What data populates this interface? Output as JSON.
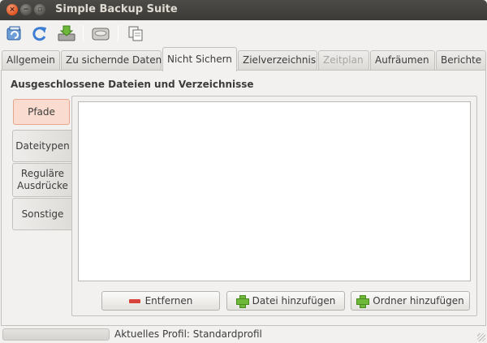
{
  "window": {
    "title": "Simple Backup Suite",
    "close_glyph": "×",
    "min_glyph": "−",
    "max_glyph": "▫"
  },
  "toolbar": {
    "icons": [
      "reload-profile-icon",
      "refresh-icon",
      "save-download-icon",
      "drive-backup-icon",
      "copy-icon"
    ]
  },
  "tabs": [
    {
      "label": "Allgemein",
      "state": "normal"
    },
    {
      "label": "Zu sichernde Daten",
      "state": "normal"
    },
    {
      "label": "Nicht Sichern",
      "state": "active"
    },
    {
      "label": "Zielverzeichnis",
      "state": "normal"
    },
    {
      "label": "Zeitplan",
      "state": "disabled"
    },
    {
      "label": "Aufräumen",
      "state": "normal"
    },
    {
      "label": "Berichte",
      "state": "normal"
    }
  ],
  "section": {
    "title": "Ausgeschlossene Dateien und Verzeichnisse"
  },
  "side_tabs": [
    {
      "label": "Pfade",
      "active": true
    },
    {
      "label": "Dateitypen",
      "active": false
    },
    {
      "label": "Reguläre Ausdrücke",
      "active": false
    },
    {
      "label": "Sonstige",
      "active": false
    }
  ],
  "buttons": {
    "remove": "Entfernen",
    "add_file": "Datei hinzufügen",
    "add_folder": "Ordner hinzufügen"
  },
  "status": {
    "text": "Aktuelles Profil: Standardprofil",
    "progress": 0
  },
  "colors": {
    "accent": "#e0531f",
    "active_tab_bg": "#f9dccf",
    "remove_red": "#d8433c",
    "add_green": "#6fb93a"
  }
}
